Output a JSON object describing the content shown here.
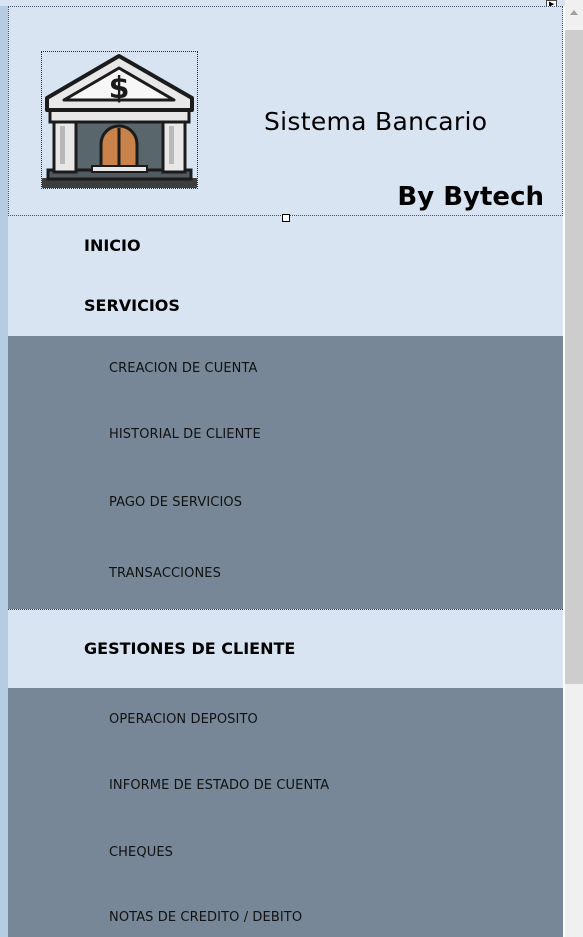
{
  "header": {
    "title": "Sistema Bancario",
    "byline": "By Bytech",
    "logo_icon": "bank-building-dollar-icon"
  },
  "menu": {
    "inicio": "INICIO",
    "servicios": {
      "label": "SERVICIOS",
      "items": [
        "CREACION DE CUENTA",
        "HISTORIAL DE CLIENTE",
        "PAGO DE SERVICIOS",
        "TRANSACCIONES"
      ]
    },
    "gestiones": {
      "label": "GESTIONES DE CLIENTE",
      "items": [
        "OPERACION DEPOSITO",
        "INFORME DE ESTADO DE CUENTA",
        "CHEQUES",
        "NOTAS DE CREDITO / DEBITO"
      ]
    }
  },
  "colors": {
    "panel_bg": "#d8e4f1",
    "submenu_bg": "#778797",
    "left_strip": "#b6cce3"
  }
}
